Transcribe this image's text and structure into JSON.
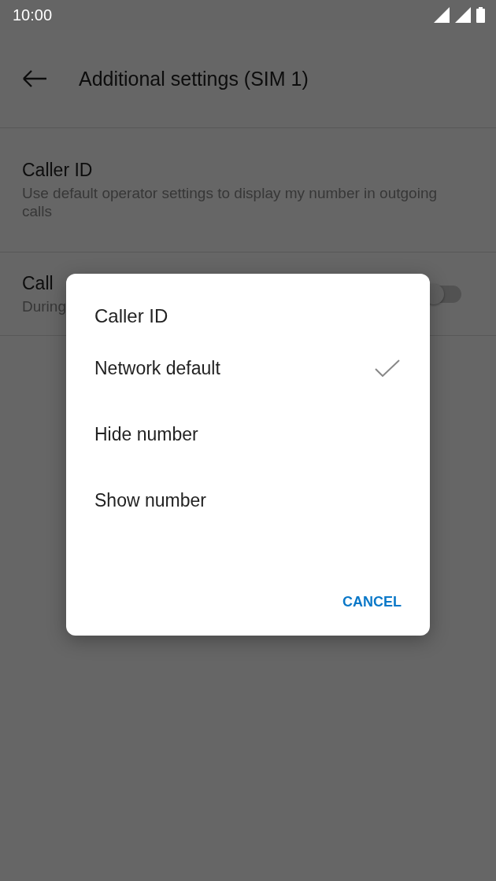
{
  "status_bar": {
    "time": "10:00"
  },
  "app_bar": {
    "title": "Additional settings (SIM 1)"
  },
  "settings": [
    {
      "kind": "option",
      "title": "Caller ID",
      "summary": "Use default operator settings to display my number in outgoing calls"
    },
    {
      "kind": "switch",
      "title": "Call",
      "summary": "During",
      "on": false
    }
  ],
  "dialog": {
    "title": "Caller ID",
    "options": [
      {
        "label": "Network default",
        "selected": true
      },
      {
        "label": "Hide number",
        "selected": false
      },
      {
        "label": "Show number",
        "selected": false
      }
    ],
    "buttons": [
      "CANCEL"
    ]
  }
}
